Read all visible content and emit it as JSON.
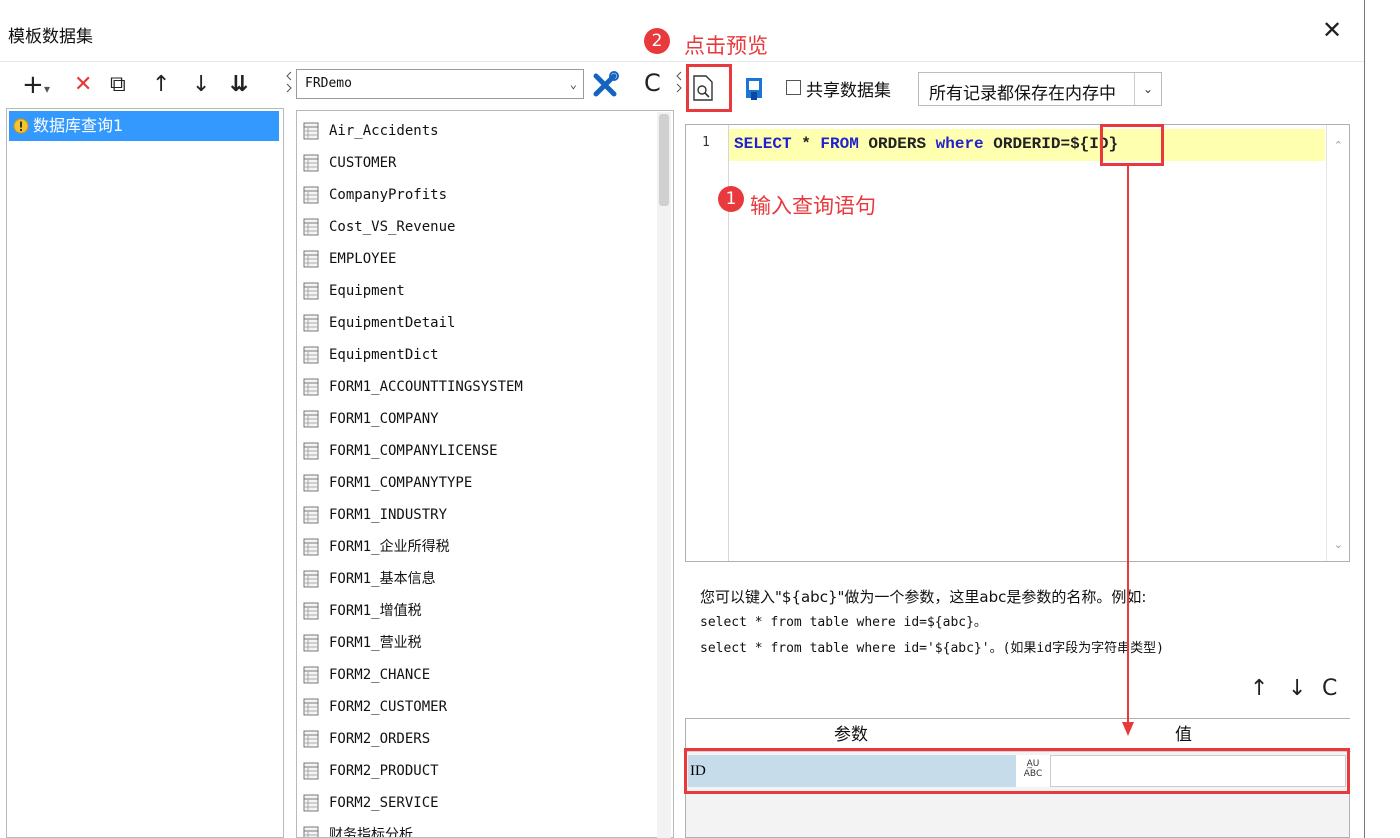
{
  "window": {
    "title": "模板数据集",
    "close_glyph": "✕"
  },
  "left_toolbar": {
    "add": "+",
    "add_menu": "▾",
    "delete": "✕",
    "copy": "⧉",
    "move_up": "↑",
    "move_down": "↓",
    "sort": "⇊"
  },
  "datasets": [
    {
      "label": "数据库查询1",
      "selected": true
    }
  ],
  "connection": {
    "selected": "FRDemo",
    "arrow": "⌄",
    "refresh": "C"
  },
  "tables": [
    "Air_Accidents",
    "CUSTOMER",
    "CompanyProfits",
    "Cost_VS_Revenue",
    "EMPLOYEE",
    "Equipment",
    "EquipmentDetail",
    "EquipmentDict",
    "FORM1_ACCOUNTTINGSYSTEM",
    "FORM1_COMPANY",
    "FORM1_COMPANYLICENSE",
    "FORM1_COMPANYTYPE",
    "FORM1_INDUSTRY",
    "FORM1_企业所得税",
    "FORM1_基本信息",
    "FORM1_增值税",
    "FORM1_营业税",
    "FORM2_CHANCE",
    "FORM2_CUSTOMER",
    "FORM2_ORDERS",
    "FORM2_PRODUCT",
    "FORM2_SERVICE",
    "财务指标分析"
  ],
  "query_toolbar": {
    "share_label": "共享数据集",
    "share_checked": false,
    "mode_selected": "所有记录都保存在内存中",
    "mode_arrow": "⌄"
  },
  "editor": {
    "line_number": "1",
    "kw1": "SELECT",
    "t1": " * ",
    "kw2": "FROM",
    "t2": " ORDERS ",
    "kw3": "where",
    "t3": " ORDERID=${ID}",
    "scroll_up": "⌃",
    "scroll_down": "⌄"
  },
  "hint": {
    "line1": "您可以键入\"${abc}\"做为一个参数，这里abc是参数的名称。例如:",
    "line2": "select * from table where id=${abc}。",
    "line3": "select * from table where id='${abc}'。(如果id字段为字符串类型)"
  },
  "param_toolbar": {
    "up": "↑",
    "down": "↓",
    "refresh": "C"
  },
  "param_table": {
    "headers": [
      "参数",
      "值"
    ],
    "rows": [
      {
        "name": "ID",
        "type_top": "A̲U",
        "type_bottom": "ABC",
        "value": ""
      }
    ]
  },
  "annotations": {
    "step1_number": "1",
    "step1_text": "输入查询语句",
    "step2_number": "2",
    "step2_text": "点击预览",
    "color": "#e8393d"
  }
}
